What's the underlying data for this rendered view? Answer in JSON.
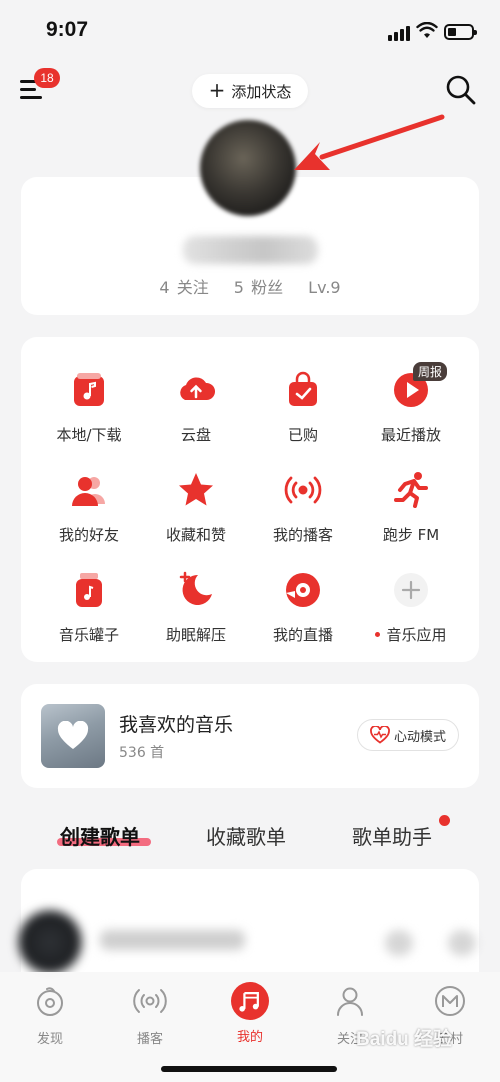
{
  "status_bar": {
    "time": "9:07"
  },
  "header": {
    "notification_count": "18",
    "add_status_label": "添加状态"
  },
  "profile": {
    "stats": [
      "4 关注",
      "5 粉丝",
      "Lv.9"
    ]
  },
  "grid": {
    "items": [
      {
        "label": "本地/下载",
        "icon": "music-file-icon"
      },
      {
        "label": "云盘",
        "icon": "cloud-upload-icon"
      },
      {
        "label": "已购",
        "icon": "purchased-bag-icon"
      },
      {
        "label": "最近播放",
        "icon": "play-icon",
        "tag": "周报"
      },
      {
        "label": "我的好友",
        "icon": "friends-icon"
      },
      {
        "label": "收藏和赞",
        "icon": "star-icon"
      },
      {
        "label": "我的播客",
        "icon": "broadcast-icon"
      },
      {
        "label": "跑步 FM",
        "icon": "running-icon"
      },
      {
        "label": "音乐罐子",
        "icon": "music-jar-icon"
      },
      {
        "label": "助眠解压",
        "icon": "sleep-moon-icon"
      },
      {
        "label": "我的直播",
        "icon": "live-icon"
      },
      {
        "label": "音乐应用",
        "icon": "plus-icon"
      }
    ]
  },
  "liked": {
    "title": "我喜欢的音乐",
    "count": "536 首",
    "mode_button": "心动模式"
  },
  "playlist_tabs": [
    "创建歌单",
    "收藏歌单",
    "歌单助手"
  ],
  "nav": [
    {
      "label": "发现",
      "icon": "discover-icon"
    },
    {
      "label": "播客",
      "icon": "podcast-icon"
    },
    {
      "label": "我的",
      "icon": "my-music-icon"
    },
    {
      "label": "关注",
      "icon": "follow-icon"
    },
    {
      "label": "云村",
      "icon": "cloud-village-icon"
    }
  ],
  "watermark": "Baidu 经验",
  "colors": {
    "accent": "#e8322d",
    "background": "#f4f4f5"
  }
}
